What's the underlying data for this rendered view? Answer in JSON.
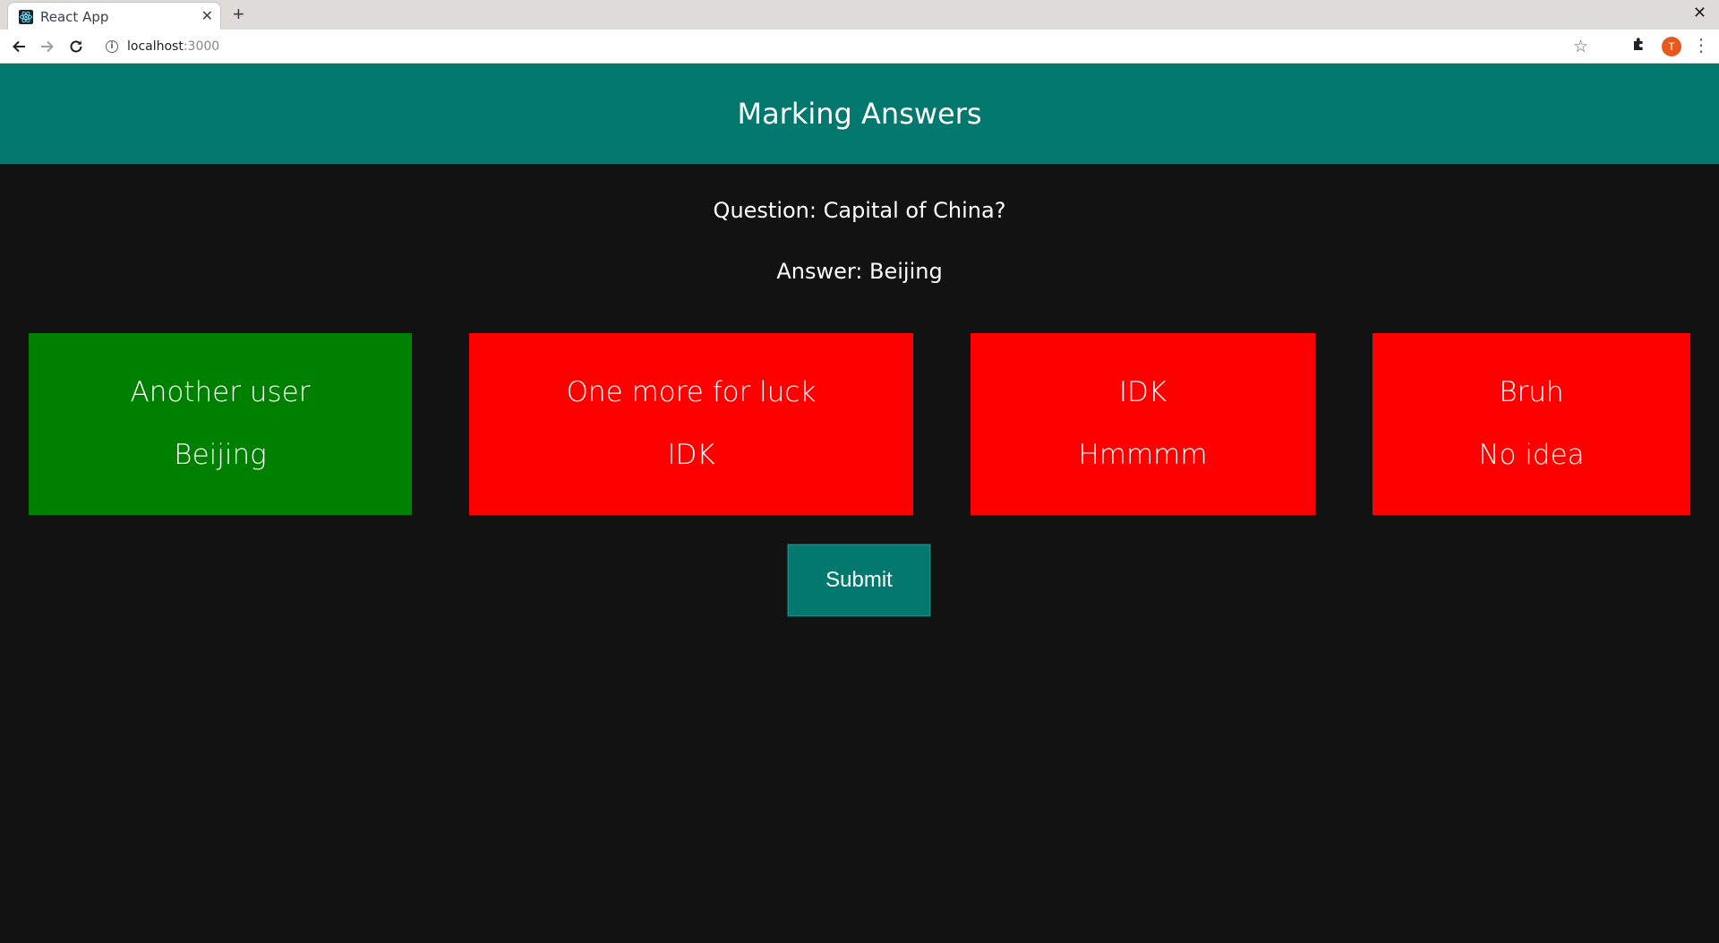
{
  "browser": {
    "tab_title": "React App",
    "tab_close": "✕",
    "new_tab": "+",
    "window_close": "✕",
    "url_host": "localhost",
    "url_port": ":3000",
    "avatar_letter": "T"
  },
  "header": {
    "title": "Marking Answers",
    "color": "#03786e"
  },
  "question_text": "Question: Capital of China?",
  "answer_text": "Answer: Beijing",
  "cards": [
    {
      "name": "Another user",
      "answer": "Beijing",
      "status": "correct",
      "color": "#008000"
    },
    {
      "name": "One more for luck",
      "answer": "IDK",
      "status": "incorrect",
      "color": "#ff0000"
    },
    {
      "name": "IDK",
      "answer": "Hmmmm",
      "status": "incorrect",
      "color": "#ff0000"
    },
    {
      "name": "Bruh",
      "answer": "No idea",
      "status": "incorrect",
      "color": "#ff0000"
    }
  ],
  "submit_label": "Submit",
  "icons": {
    "back": "back-arrow-icon",
    "forward": "forward-arrow-icon",
    "reload": "reload-icon",
    "info": "info-icon",
    "star": "star-icon",
    "extensions": "puzzle-icon",
    "menu": "kebab-menu-icon",
    "favicon": "react-logo-icon"
  }
}
